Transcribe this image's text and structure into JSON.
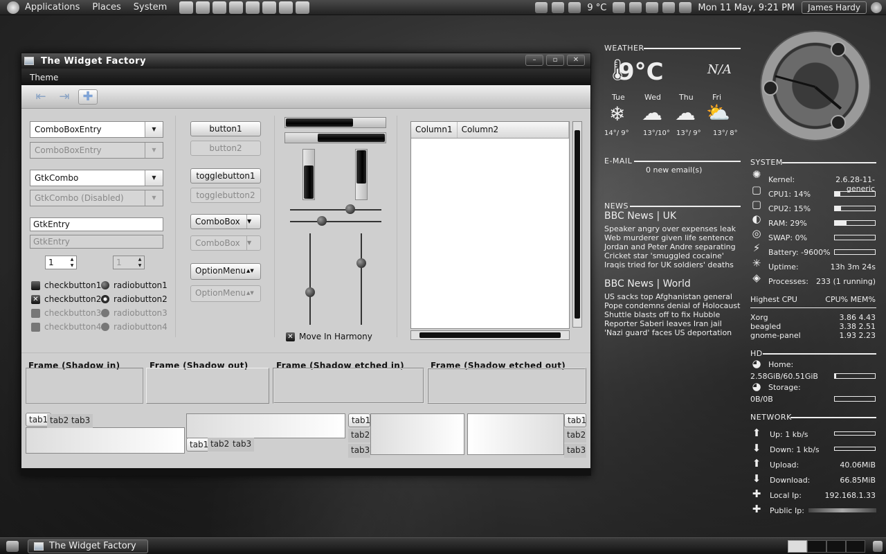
{
  "top_panel": {
    "menus": [
      "Applications",
      "Places",
      "System"
    ],
    "weather_temp": "9 °C",
    "clock": "Mon 11 May,  9:21 PM",
    "user": "James Hardy"
  },
  "window": {
    "title": "The Widget Factory",
    "menu": "Theme",
    "combos": {
      "c1": "ComboBoxEntry",
      "c2": "ComboBoxEntry",
      "c3": "GtkCombo",
      "c4": "GtkCombo (Disabled)"
    },
    "entries": {
      "e1": "GtkEntry",
      "e2": "GtkEntry"
    },
    "spin": {
      "s1": "1",
      "s2": "1"
    },
    "checks": {
      "cb1": "checkbutton1",
      "cb2": "checkbutton2",
      "cb3": "checkbutton3",
      "cb4": "checkbutton4"
    },
    "radios": {
      "rb1": "radiobutton1",
      "rb2": "radiobutton2",
      "rb3": "radiobutton3",
      "rb4": "radiobutton4"
    },
    "buttons": {
      "b1": "button1",
      "b2": "button2",
      "t1": "togglebutton1",
      "t2": "togglebutton2",
      "cbx1": "ComboBox",
      "cbx2": "ComboBox",
      "om1": "OptionMenu",
      "om2": "OptionMenu"
    },
    "move_harmony": "Move In Harmony",
    "columns": [
      "Column1",
      "Column2"
    ],
    "frames": [
      "Frame (Shadow in)",
      "Frame (Shadow out)",
      "Frame (Shadow etched in)",
      "Frame (Shadow etched out)"
    ],
    "tabs": [
      "tab1",
      "tab2",
      "tab3"
    ]
  },
  "conky": {
    "weather": {
      "label": "WEATHER",
      "temp": "9°C",
      "na": "N/A",
      "days": [
        {
          "day": "Tue",
          "temp": "14°/ 9°"
        },
        {
          "day": "Wed",
          "temp": "13°/10°"
        },
        {
          "day": "Thu",
          "temp": "13°/ 9°"
        },
        {
          "day": "Fri",
          "temp": "13°/ 8°"
        }
      ]
    },
    "email": {
      "label": "E-MAIL",
      "text": "0 new email(s)"
    },
    "news": {
      "label": "NEWS",
      "uk_title": "BBC News | UK",
      "uk": [
        "Speaker angry over expenses leak",
        "Web murderer given life sentence",
        "Jordan and Peter Andre separating",
        "Cricket star 'smuggled cocaine'",
        "Iraqis tried for UK soldiers' deaths"
      ],
      "world_title": "BBC News | World",
      "world": [
        "US sacks top Afghanistan general",
        "Pope condemns denial of Holocaust",
        "Shuttle blasts off to fix Hubble",
        "Reporter Saberi leaves Iran jail",
        "'Nazi guard' faces US deportation"
      ]
    },
    "system": {
      "label": "SYSTEM",
      "kernel_label": "Kernel:",
      "kernel": "2.6.28-11-generic",
      "cpu1_label": "CPU1: 14%",
      "cpu1": 14,
      "cpu2_label": "CPU2: 15%",
      "cpu2": 15,
      "ram_label": "RAM: 29%",
      "ram": 29,
      "swap_label": "SWAP: 0%",
      "swap": 0,
      "battery_label": "Battery: -9600%",
      "uptime_label": "Uptime:",
      "uptime": "13h 3m 24s",
      "proc_label": "Processes:",
      "proc": "233 (1 running)",
      "highest": "Highest CPU",
      "cols": "CPU% MEM%",
      "top": [
        {
          "name": "Xorg",
          "vals": "3.86  4.43"
        },
        {
          "name": "beagled",
          "vals": "3.38  2.51"
        },
        {
          "name": "gnome-panel",
          "vals": "1.93  2.23"
        }
      ]
    },
    "hd": {
      "label": "HD",
      "home_label": "Home:",
      "home": "2.58GiB/60.51GiB",
      "home_used": 4,
      "storage_label": "Storage:",
      "storage": "0B/0B",
      "storage_used": 0
    },
    "network": {
      "label": "NETWORK",
      "up": "Up: 1 kb/s",
      "down": "Down: 1 kb/s",
      "upload_label": "Upload:",
      "upload": "40.06MiB",
      "download_label": "Download:",
      "download": "66.85MiB",
      "local_label": "Local Ip:",
      "local": "192.168.1.33",
      "public_label": "Public Ip:"
    }
  },
  "taskbar": {
    "task": "The Widget Factory"
  }
}
